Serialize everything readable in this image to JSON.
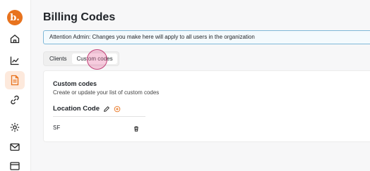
{
  "brand": {
    "logo_text": "b.",
    "accent_color": "#e8731e"
  },
  "sidebar": {
    "items": [
      {
        "icon": "home-icon"
      },
      {
        "icon": "chart-icon"
      },
      {
        "icon": "document-icon",
        "active": true
      },
      {
        "icon": "link-icon"
      },
      {
        "icon": "gear-icon"
      },
      {
        "icon": "mail-icon"
      },
      {
        "icon": "window-icon"
      }
    ]
  },
  "page": {
    "title": "Billing Codes",
    "banner": "Attention Admin: Changes you make here will apply to all users in the organization"
  },
  "tabs": [
    {
      "label": "Clients",
      "active": false
    },
    {
      "label": "Custom codes",
      "active": true
    }
  ],
  "card": {
    "title": "Custom codes",
    "subtitle": "Create or update your list of custom codes",
    "section": {
      "title": "Location Code",
      "edit_icon": "pencil-icon",
      "add_icon": "plus-circle-icon",
      "rows": [
        {
          "value": "SF",
          "delete_icon": "trash-icon"
        }
      ]
    }
  }
}
